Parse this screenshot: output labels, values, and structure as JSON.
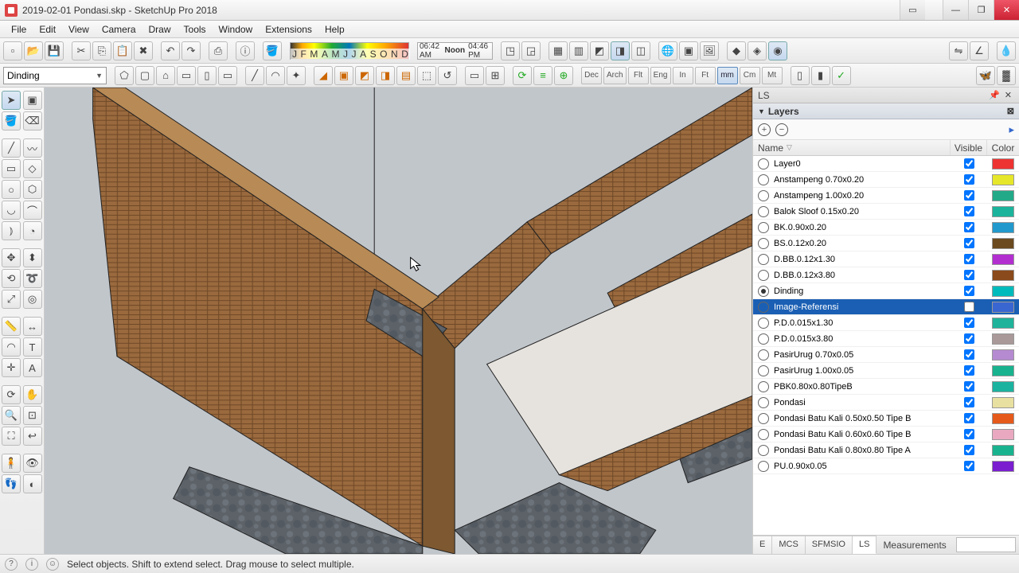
{
  "window": {
    "title": "2019-02-01 Pondasi.skp - SketchUp Pro 2018"
  },
  "menu": [
    "File",
    "Edit",
    "View",
    "Camera",
    "Draw",
    "Tools",
    "Window",
    "Extensions",
    "Help"
  ],
  "shadow": {
    "months": [
      "J",
      "F",
      "M",
      "A",
      "M",
      "J",
      "J",
      "A",
      "S",
      "O",
      "N",
      "D"
    ],
    "t1": "06:42 AM",
    "noon": "Noon",
    "t2": "04:46 PM"
  },
  "layer_dropdown": {
    "current": "Dinding"
  },
  "units": [
    "Dec",
    "Arch",
    "Flt",
    "Eng",
    "In",
    "Ft",
    "mm",
    "Cm",
    "Mt"
  ],
  "unit_selected": "mm",
  "panel": {
    "tray": "LS",
    "section": "Layers",
    "columns": {
      "name": "Name",
      "vis": "Visible",
      "color": "Color"
    },
    "layers": [
      {
        "name": "Layer0",
        "on": false,
        "vis": true,
        "color": "#e33"
      },
      {
        "name": "Anstampeng 0.70x0.20",
        "on": false,
        "vis": true,
        "color": "#e6e62a"
      },
      {
        "name": "Anstampeng 1.00x0.20",
        "on": false,
        "vis": true,
        "color": "#2a8"
      },
      {
        "name": "Balok Sloof 0.15x0.20",
        "on": false,
        "vis": true,
        "color": "#1bb39b"
      },
      {
        "name": "BK.0.90x0.20",
        "on": false,
        "vis": true,
        "color": "#29c"
      },
      {
        "name": "BS.0.12x0.20",
        "on": false,
        "vis": true,
        "color": "#6b4a1f"
      },
      {
        "name": "D.BB.0.12x1.30",
        "on": false,
        "vis": true,
        "color": "#b22ecf"
      },
      {
        "name": "D.BB.0.12x3.80",
        "on": false,
        "vis": true,
        "color": "#8a4a1b"
      },
      {
        "name": "Dinding",
        "on": true,
        "vis": true,
        "color": "#0bb"
      },
      {
        "name": "Image-Referensi",
        "on": false,
        "vis": false,
        "color": "#3a66d1",
        "sel": true
      },
      {
        "name": "P.D.0.015x1.30",
        "on": false,
        "vis": true,
        "color": "#20b39b"
      },
      {
        "name": "P.D.0.015x3.80",
        "on": false,
        "vis": true,
        "color": "#a99"
      },
      {
        "name": "PasirUrug 0.70x0.05",
        "on": false,
        "vis": true,
        "color": "#b58ad1"
      },
      {
        "name": "PasirUrug 1.00x0.05",
        "on": false,
        "vis": true,
        "color": "#18b38e"
      },
      {
        "name": "PBK0.80x0.80TipeB",
        "on": false,
        "vis": true,
        "color": "#1bb3a0"
      },
      {
        "name": "Pondasi",
        "on": false,
        "vis": true,
        "color": "#e8e0a0"
      },
      {
        "name": "Pondasi Batu Kali 0.50x0.50 Tipe B",
        "on": false,
        "vis": true,
        "color": "#e55a1b"
      },
      {
        "name": "Pondasi Batu Kali 0.60x0.60 Tipe B",
        "on": false,
        "vis": true,
        "color": "#e9a8c0"
      },
      {
        "name": "Pondasi Batu Kali 0.80x0.80 Tipe A",
        "on": false,
        "vis": true,
        "color": "#18b38e"
      },
      {
        "name": "PU.0.90x0.05",
        "on": false,
        "vis": true,
        "color": "#7a1ecf"
      }
    ],
    "tabs": [
      "E",
      "MCS",
      "SFMSIO",
      "LS"
    ],
    "tab_active": "LS"
  },
  "measurements_label": "Measurements",
  "status": "Select objects. Shift to extend select. Drag mouse to select multiple."
}
